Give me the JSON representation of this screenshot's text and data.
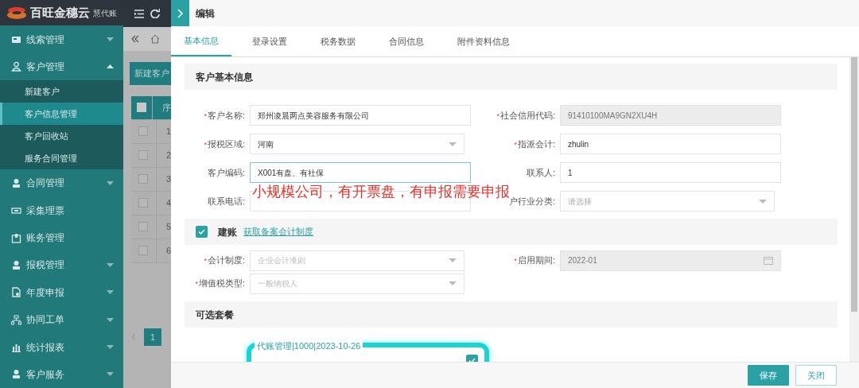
{
  "app": {
    "brand": "百旺金穗云",
    "product": "慧代账"
  },
  "sidebar": {
    "items": [
      {
        "label": "线索管理",
        "expanded": false
      },
      {
        "label": "客户管理",
        "expanded": true,
        "children": [
          {
            "label": "新建客户",
            "selected": false
          },
          {
            "label": "客户信息管理",
            "selected": true
          },
          {
            "label": "客户回收站",
            "selected": false
          },
          {
            "label": "服务合同管理",
            "selected": false
          }
        ]
      },
      {
        "label": "合同管理",
        "expanded": false
      },
      {
        "label": "采集理票"
      },
      {
        "label": "账务管理"
      },
      {
        "label": "报税管理",
        "expanded": false
      },
      {
        "label": "年度申报",
        "expanded": false
      },
      {
        "label": "协同工单",
        "expanded": false
      },
      {
        "label": "统计报表",
        "expanded": false
      },
      {
        "label": "客户服务",
        "expanded": false
      }
    ]
  },
  "background_page": {
    "new_button": "新建客户",
    "column": "序",
    "header_checked": false,
    "rows": [
      {
        "number": "1",
        "checked": false
      },
      {
        "number": "2",
        "checked": false
      },
      {
        "number": "3",
        "checked": false
      },
      {
        "number": "4",
        "checked": false
      },
      {
        "number": "5",
        "checked": false
      },
      {
        "number": "6",
        "checked": false
      }
    ],
    "page": "1"
  },
  "dialog": {
    "title": "编辑",
    "tabs": [
      {
        "label": "基本信息",
        "selected": true
      },
      {
        "label": "登录设置",
        "selected": false
      },
      {
        "label": "税务数据",
        "selected": false
      },
      {
        "label": "合同信息",
        "selected": false
      },
      {
        "label": "附件资料信息",
        "selected": false
      }
    ],
    "basic_section": {
      "title": "客户基本信息",
      "rows": [
        [
          {
            "mark": "*",
            "label": "客户名称:",
            "kind": "text",
            "value": "郑州凌晨两点美容服务有限公司",
            "disabled": false,
            "focused": false
          },
          {
            "mark": "*",
            "label": "社会信用代码:",
            "kind": "text",
            "value": "91410100MA9GN2XU4H",
            "disabled": true,
            "focused": false
          }
        ],
        [
          {
            "mark": "*",
            "label": "报税区域:",
            "kind": "select",
            "value": "河南",
            "disabled": false,
            "focused": false
          },
          {
            "mark": "*",
            "label": "指派会计:",
            "kind": "text",
            "value": "zhulin",
            "disabled": false,
            "focused": false
          }
        ],
        [
          {
            "label": "客户编码:",
            "kind": "text",
            "value": "X001有盘、有社保",
            "disabled": false,
            "focused": true
          },
          {
            "label": "联系人:",
            "kind": "text",
            "value": "1",
            "disabled": false,
            "focused": false
          }
        ],
        [
          {
            "label": "联系电话:",
            "kind": "text",
            "disabled": false,
            "focused": false
          },
          {
            "label": "户行业分类:",
            "kind": "select",
            "placeholder": "请选择",
            "focused": false
          }
        ]
      ]
    },
    "annotation": "小规模公司，有开票盘，有申报需要申报",
    "ledger_section": {
      "checked": true,
      "title": "建账",
      "link": "获取备案会计制度",
      "rows": [
        [
          {
            "mark": "*",
            "label": "会计制度:",
            "kind": "select",
            "value": "企业会计准则",
            "disabled": true,
            "focused": false
          },
          {
            "mark": "*",
            "label": "启用期间:",
            "kind": "date",
            "value": "2022-01",
            "disabled": true,
            "focused": false
          }
        ],
        [
          {
            "mark": "*",
            "label": "增值税类型:",
            "kind": "select",
            "value": "一般纳税人",
            "disabled": true,
            "focused": false
          }
        ]
      ]
    },
    "package_section": {
      "title": "可选套餐",
      "packages": [
        {
          "label": "代账管理|1000|2023-10-26",
          "checked": true
        }
      ]
    },
    "buttons": [
      {
        "label": "保存",
        "kind": "primary"
      },
      {
        "label": "关闭",
        "kind": "outline"
      }
    ]
  }
}
